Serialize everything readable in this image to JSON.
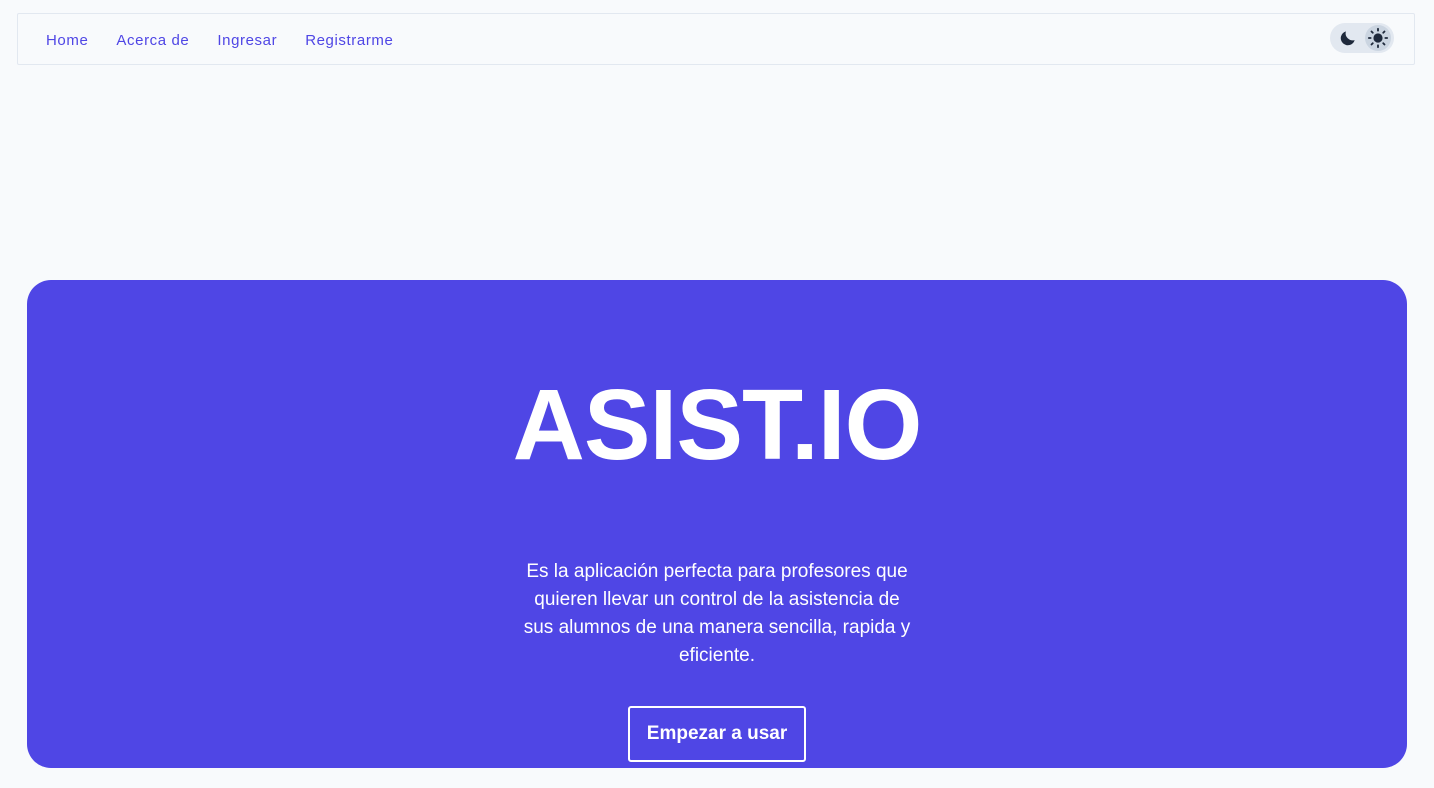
{
  "nav": {
    "links": [
      "Home",
      "Acerca de",
      "Ingresar",
      "Registrarme"
    ],
    "theme_toggle": {
      "options": [
        "moon-icon",
        "sun-icon"
      ],
      "selected": "light"
    }
  },
  "hero": {
    "title": "ASIST.IO",
    "description": "Es la aplicación perfecta para profesores que quieren llevar un control de la asistencia de sus alumnos de una manera sencilla, rapida y eficiente.",
    "cta_label": "Empezar a usar",
    "background_color": "#4f46e5"
  },
  "colors": {
    "accent": "#4f46e5",
    "page_background": "#f8fafc"
  }
}
